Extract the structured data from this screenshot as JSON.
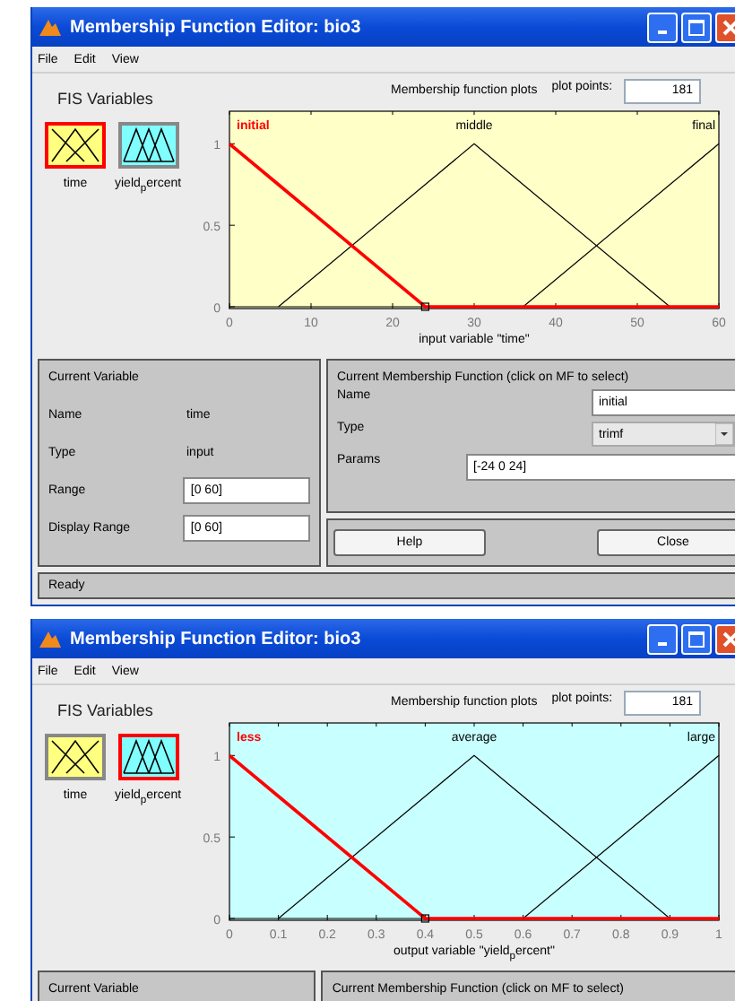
{
  "windows": [
    {
      "title": "Membership Function Editor: bio3",
      "menu": [
        "File",
        "Edit",
        "View"
      ],
      "fis_label": "FIS Variables",
      "variables": [
        {
          "name": "time",
          "kind": "input",
          "selected": true
        },
        {
          "name": "yield$_{p}$ercent",
          "kind": "output",
          "selected": false
        }
      ],
      "plots_label": "Membership function plots",
      "plot_points_label": "plot points:",
      "plot_points": "181",
      "membership_functions": [
        {
          "selected": true
        },
        {
          "selected": false
        },
        {
          "selected": false
        }
      ],
      "xlabel": "input variable \"time\"",
      "chart_data": {
        "type": "line",
        "x": [
          0,
          6,
          24,
          30,
          36,
          54,
          60
        ],
        "series": [
          {
            "name": "initial",
            "color": "#ff0000",
            "values": [
              1,
              0.75,
              0,
              0,
              0,
              0,
              0
            ]
          },
          {
            "name": "middle",
            "color": "#000000",
            "values": [
              null,
              0,
              0.75,
              1,
              0.75,
              0,
              null
            ]
          },
          {
            "name": "final",
            "color": "#000000",
            "values": [
              null,
              null,
              null,
              null,
              0,
              0.75,
              1
            ]
          }
        ],
        "legend": "top",
        "xlim": [
          0,
          60
        ],
        "ylim": [
          0,
          1.2
        ],
        "xticks": [
          0,
          10,
          20,
          30,
          40,
          50,
          60
        ],
        "yticks": [
          0,
          0.5,
          1
        ]
      },
      "current_variable": {
        "title": "Current Variable",
        "rows": [
          {
            "kind": "text",
            "label": "Name",
            "value": "time"
          },
          {
            "kind": "text",
            "label": "Type",
            "value": "input"
          },
          {
            "kind": "field",
            "label": "Range",
            "value": "[0 60]"
          },
          {
            "kind": "field",
            "label": "Display Range",
            "value": "[0 60]"
          }
        ]
      },
      "current_mf": {
        "title": "Current Membership Function (click on MF to select)",
        "name_label": "Name",
        "name": "initial",
        "type_label": "Type",
        "type": "trimf",
        "params_label": "Params",
        "params": "[-24 0 24]"
      },
      "buttons": [
        "Help",
        "Close"
      ],
      "status": "Ready"
    },
    {
      "title": "Membership Function Editor: bio3",
      "menu": [
        "File",
        "Edit",
        "View"
      ],
      "fis_label": "FIS Variables",
      "variables": [
        {
          "name": "time",
          "kind": "input",
          "selected": false
        },
        {
          "name": "yield$_{p}$ercent",
          "kind": "output",
          "selected": true
        }
      ],
      "plots_label": "Membership function plots",
      "plot_points_label": "plot points:",
      "plot_points": "181",
      "membership_functions": [
        {
          "selected": true
        },
        {
          "selected": false
        },
        {
          "selected": false
        }
      ],
      "xlabel": "output variable \"yield$_{p}$ercent\"",
      "chart_data": {
        "type": "line",
        "x": [
          0,
          0.1,
          0.4,
          0.5,
          0.6,
          0.9,
          1
        ],
        "series": [
          {
            "name": "less",
            "color": "#ff0000",
            "values": [
              1,
              0.75,
              0,
              0,
              0,
              0,
              0
            ]
          },
          {
            "name": "average",
            "color": "#000000",
            "values": [
              null,
              0,
              0.75,
              1,
              0.75,
              0,
              null
            ]
          },
          {
            "name": "large",
            "color": "#000000",
            "values": [
              null,
              null,
              null,
              null,
              0,
              0.75,
              1
            ]
          }
        ],
        "legend": "top",
        "xlim": [
          0,
          1
        ],
        "ylim": [
          0,
          1.2
        ],
        "xticks": [
          0,
          0.1,
          0.2,
          0.3,
          0.4,
          0.5,
          0.6,
          0.7,
          0.8,
          0.9,
          1
        ],
        "yticks": [
          0,
          0.5,
          1
        ]
      },
      "current_variable": {
        "title": "Current Variable"
      },
      "current_mf": {
        "title": "Current Membership Function (click on MF to select)"
      }
    }
  ]
}
